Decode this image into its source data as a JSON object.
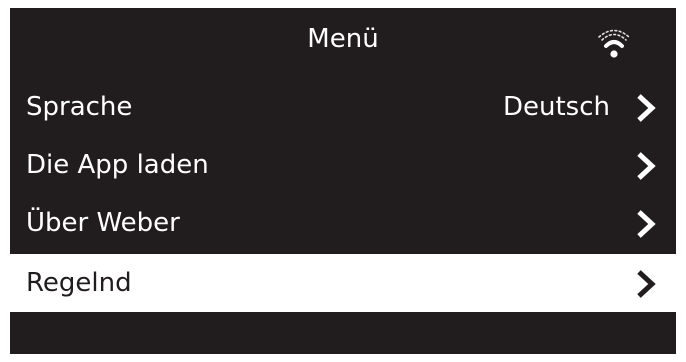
{
  "header": {
    "title": "Menü",
    "status_icon": "wifi-icon"
  },
  "menu": {
    "items": [
      {
        "label": "Sprache",
        "value": "Deutsch",
        "selected": false
      },
      {
        "label": "Die App laden",
        "value": "",
        "selected": false
      },
      {
        "label": "Über Weber",
        "value": "",
        "selected": false
      },
      {
        "label": "Regelnd",
        "value": "",
        "selected": true
      }
    ]
  },
  "colors": {
    "background": "#211c1d",
    "text": "#ffffff",
    "selected_background": "#ffffff",
    "selected_text": "#211c1d"
  },
  "icons": {
    "row_arrow": "chevron-right-icon"
  }
}
